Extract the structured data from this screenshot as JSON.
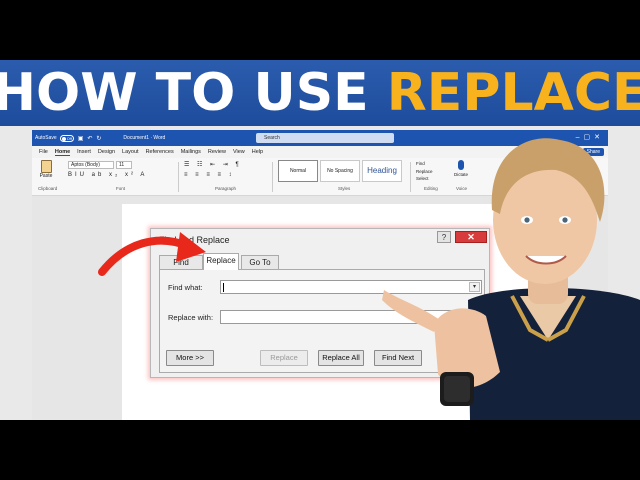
{
  "banner": {
    "lead": "HOW TO USE ",
    "accent": "REPLACE"
  },
  "word": {
    "titlebar": {
      "autosave": "AutoSave",
      "toggle": "Off",
      "doc_title": "Document1 · Word",
      "search_placeholder": "Search"
    },
    "menu": [
      "File",
      "Home",
      "Insert",
      "Design",
      "Layout",
      "References",
      "Mailings",
      "Review",
      "View",
      "Help"
    ],
    "share": "Share",
    "ribbon": {
      "paste": "Paste",
      "font_name": "Aptos (Body)",
      "font_size": "11",
      "styles": [
        "Normal",
        "No Spacing",
        "Heading"
      ],
      "editing": [
        "Find",
        "Replace",
        "Select"
      ],
      "dictate": "Dictate",
      "groups": [
        "Clipboard",
        "Font",
        "Paragraph",
        "Styles",
        "Editing",
        "Voice"
      ]
    }
  },
  "dialog": {
    "title": "Find and Replace",
    "tabs": [
      "Find",
      "Replace",
      "Go To"
    ],
    "find_label": "Find what:",
    "replace_label": "Replace with:",
    "buttons": {
      "more": "More >>",
      "replace": "Replace",
      "replace_all": "Replace All",
      "find_next": "Find Next"
    }
  },
  "colors": {
    "banner": "#2159aa",
    "accent": "#f7b21d",
    "word_blue": "#1d54b0",
    "arrow": "#e8281b"
  }
}
